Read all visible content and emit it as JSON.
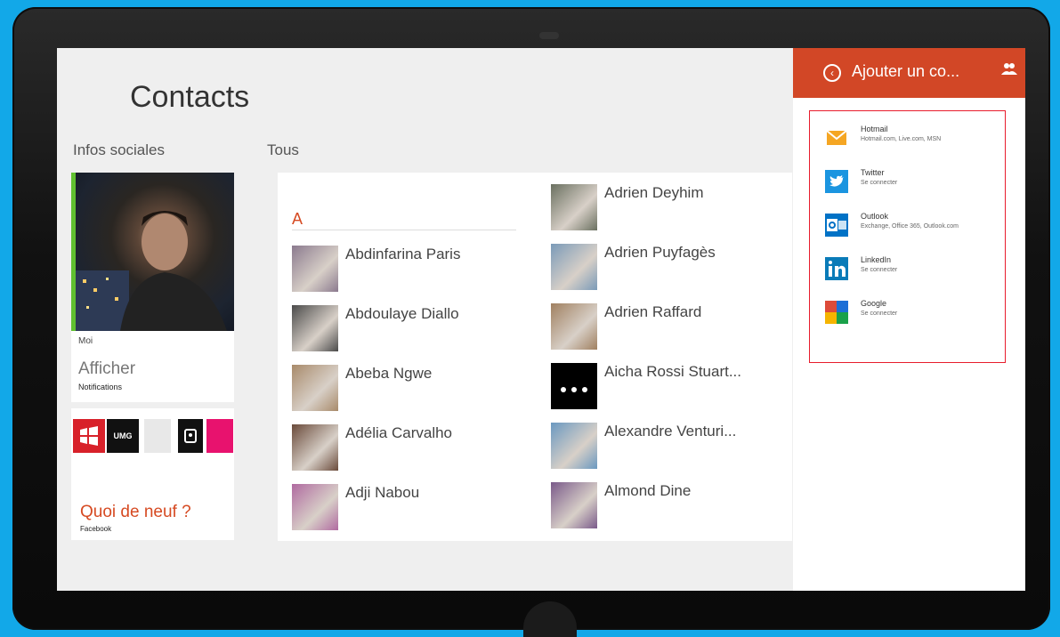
{
  "page": {
    "title": "Contacts",
    "section_social": "Infos sociales",
    "section_all": "Tous"
  },
  "me_tile": {
    "label": "Moi",
    "action": "Afficher",
    "sub": "Notifications"
  },
  "news_tile": {
    "title": "Quoi de neuf ?",
    "sub": "Facebook",
    "logo_text": "UMG"
  },
  "contacts": {
    "letter": "A",
    "column1": [
      {
        "name": "Abdinfarina Paris",
        "avatar_color": "#8b7a8e"
      },
      {
        "name": "Abdoulaye Diallo",
        "avatar_color": "#4a4a4a"
      },
      {
        "name": "Abeba Ngwe",
        "avatar_color": "#a88a6a"
      },
      {
        "name": "Adélia Carvalho",
        "avatar_color": "#6a4a3a"
      },
      {
        "name": "Adji Nabou",
        "avatar_color": "#b06aa0"
      }
    ],
    "column2": [
      {
        "name": "Adrien Deyhim",
        "avatar_color": "#6a7060"
      },
      {
        "name": "Adrien Puyfagès",
        "avatar_color": "#7a9ab8"
      },
      {
        "name": "Adrien Raffard",
        "avatar_color": "#a08060"
      },
      {
        "name": "Aicha Rossi Stuart...",
        "avatar_color": "#000000"
      },
      {
        "name": "Alexandre Venturi...",
        "avatar_color": "#6a98c0"
      },
      {
        "name": "Almond Dine",
        "avatar_color": "#7a5a8a"
      }
    ]
  },
  "flyout": {
    "title": "Ajouter un co...",
    "accent_color": "#d24726",
    "accounts": [
      {
        "name": "Hotmail",
        "sub": "Hotmail.com, Live.com, MSN",
        "icon": "envelope-icon",
        "color": "#f5a623"
      },
      {
        "name": "Twitter",
        "sub": "Se connecter",
        "icon": "twitter-icon",
        "color": "#1b95e0"
      },
      {
        "name": "Outlook",
        "sub": "Exchange, Office 365, Outlook.com",
        "icon": "outlook-icon",
        "color": "#0072c6"
      },
      {
        "name": "LinkedIn",
        "sub": "Se connecter",
        "icon": "linkedin-icon",
        "color": "#0a7bb8"
      },
      {
        "name": "Google",
        "sub": "Se connecter",
        "icon": "google-icon",
        "color": "#dd4b39"
      }
    ]
  }
}
